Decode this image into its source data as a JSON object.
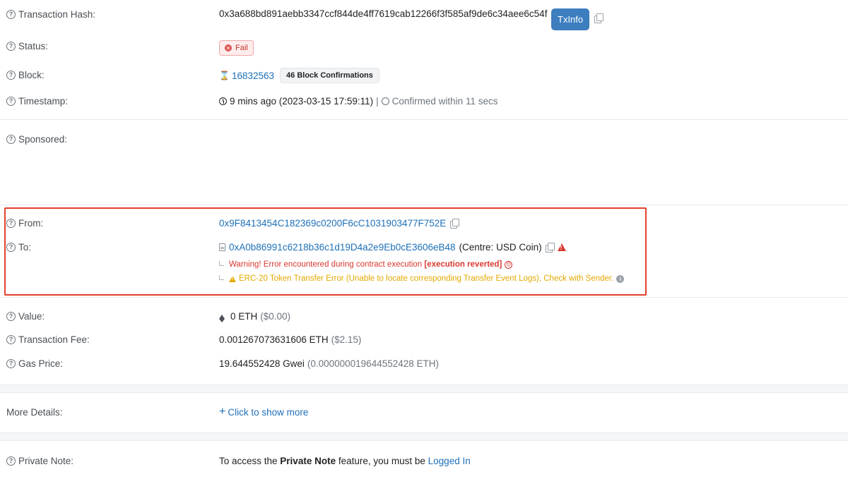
{
  "tx_hash": {
    "label": "Transaction Hash:",
    "value": "0x3a688bd891aebb3347ccf844de4ff7619cab12266f3f585af9de6c34aee6c54f",
    "button": "TxInfo"
  },
  "status": {
    "label": "Status:",
    "badge": "Fail"
  },
  "block": {
    "label": "Block:",
    "number": "16832563",
    "confirmations": "46 Block Confirmations"
  },
  "timestamp": {
    "label": "Timestamp:",
    "ago": "9 mins ago (2023-03-15 17:59:11)",
    "sep": "|",
    "confirmed": "Confirmed within 11 secs"
  },
  "sponsored": {
    "label": "Sponsored:"
  },
  "from": {
    "label": "From:",
    "address": "0x9F8413454C182369c0200F6cC1031903477F752E"
  },
  "to": {
    "label": "To:",
    "address": "0xA0b86991c6218b36c1d19D4a2e9Eb0cE3606eB48",
    "name": "(Centre: USD Coin)",
    "warning_prefix": "Warning! Error encountered during contract execution ",
    "warning_bold": "[execution reverted]",
    "erc20_error": "ERC-20 Token Transfer Error (Unable to locate corresponding Transfer Event Logs), Check with Sender."
  },
  "value": {
    "label": "Value:",
    "amount": "0 ETH",
    "usd": "($0.00)"
  },
  "fee": {
    "label": "Transaction Fee:",
    "amount": "0.001267073631606 ETH",
    "usd": "($2.15)"
  },
  "gas": {
    "label": "Gas Price:",
    "amount": "19.644552428 Gwei",
    "eth": "(0.000000019644552428 ETH)"
  },
  "more": {
    "label": "More Details:",
    "link": "Click to show more"
  },
  "note": {
    "label": "Private Note:",
    "pre": "To access the ",
    "bold": "Private Note",
    "mid": " feature, you must be ",
    "link": "Logged In"
  },
  "colors": {
    "link": "#1e70b8",
    "fail": "#d9382f",
    "warning": "#e3a800",
    "highlight": "#e4412f",
    "button": "#3d7ebf"
  }
}
